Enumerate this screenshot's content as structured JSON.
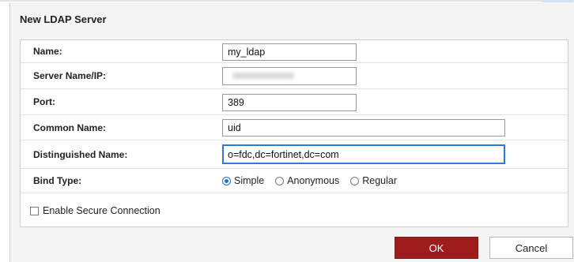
{
  "dialog": {
    "title": "New LDAP Server"
  },
  "form": {
    "name": {
      "label": "Name:",
      "value": "my_ldap"
    },
    "server": {
      "label": "Server Name/IP:",
      "value": ""
    },
    "port": {
      "label": "Port:",
      "value": "389"
    },
    "common_name": {
      "label": "Common Name:",
      "value": "uid"
    },
    "distinguished_name": {
      "label": "Distinguished Name:",
      "value": "o=fdc,dc=fortinet,dc=com"
    },
    "bind_type": {
      "label": "Bind Type:",
      "options": [
        "Simple",
        "Anonymous",
        "Regular"
      ],
      "selected": "Simple"
    },
    "secure_connection": {
      "label": "Enable Secure Connection",
      "checked": false
    }
  },
  "buttons": {
    "ok": "OK",
    "cancel": "Cancel"
  },
  "colors": {
    "ok_button": "#9e1c1c",
    "focus_border": "#2d7ad9",
    "radio_selected": "#2b6fc4"
  }
}
